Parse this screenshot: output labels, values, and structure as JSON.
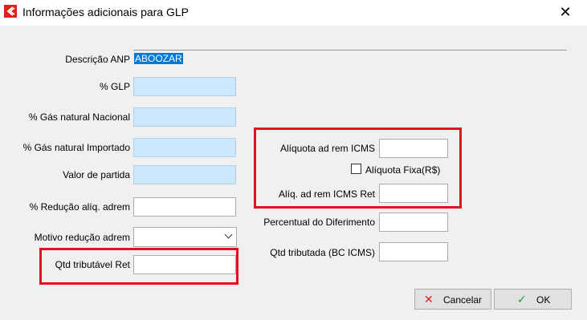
{
  "window": {
    "title": "Informações adicionais para GLP",
    "close_glyph": "✕"
  },
  "form": {
    "descricao_anp_label": "Descrição ANP",
    "descricao_anp_value": "ABOOZAR",
    "pct_glp_label": "% GLP",
    "pct_gas_nacional_label": "% Gás natural Nacional",
    "pct_gas_importado_label": "% Gás natural Importado",
    "valor_partida_label": "Valor de partida",
    "pct_reducao_label": "% Redução alíq. adrem",
    "motivo_reducao_label": "Motivo redução adrem",
    "qtd_tributavel_ret_label": "Qtd tributável Ret",
    "aliquota_adrem_icms_label": "Alíquota ad rem ICMS",
    "aliquota_fixa_label": "Alíquota Fixa(R$)",
    "aliquota_fixa_checked": false,
    "aliq_adrem_icms_ret_label": "Alíq. ad rem ICMS Ret",
    "percentual_diferimento_label": "Percentual do Diferimento",
    "qtd_tributada_label": "Qtd tributada (BC ICMS)"
  },
  "buttons": {
    "cancel_label": "Cancelar",
    "ok_label": "OK"
  },
  "icons": [
    "app-logo-icon",
    "close-icon",
    "chevron-down-icon",
    "cancel-x-icon",
    "ok-check-icon"
  ],
  "colors": {
    "highlight_box": "#e0141e",
    "required_field": "#cce8ff",
    "selection": "#0078d7"
  }
}
